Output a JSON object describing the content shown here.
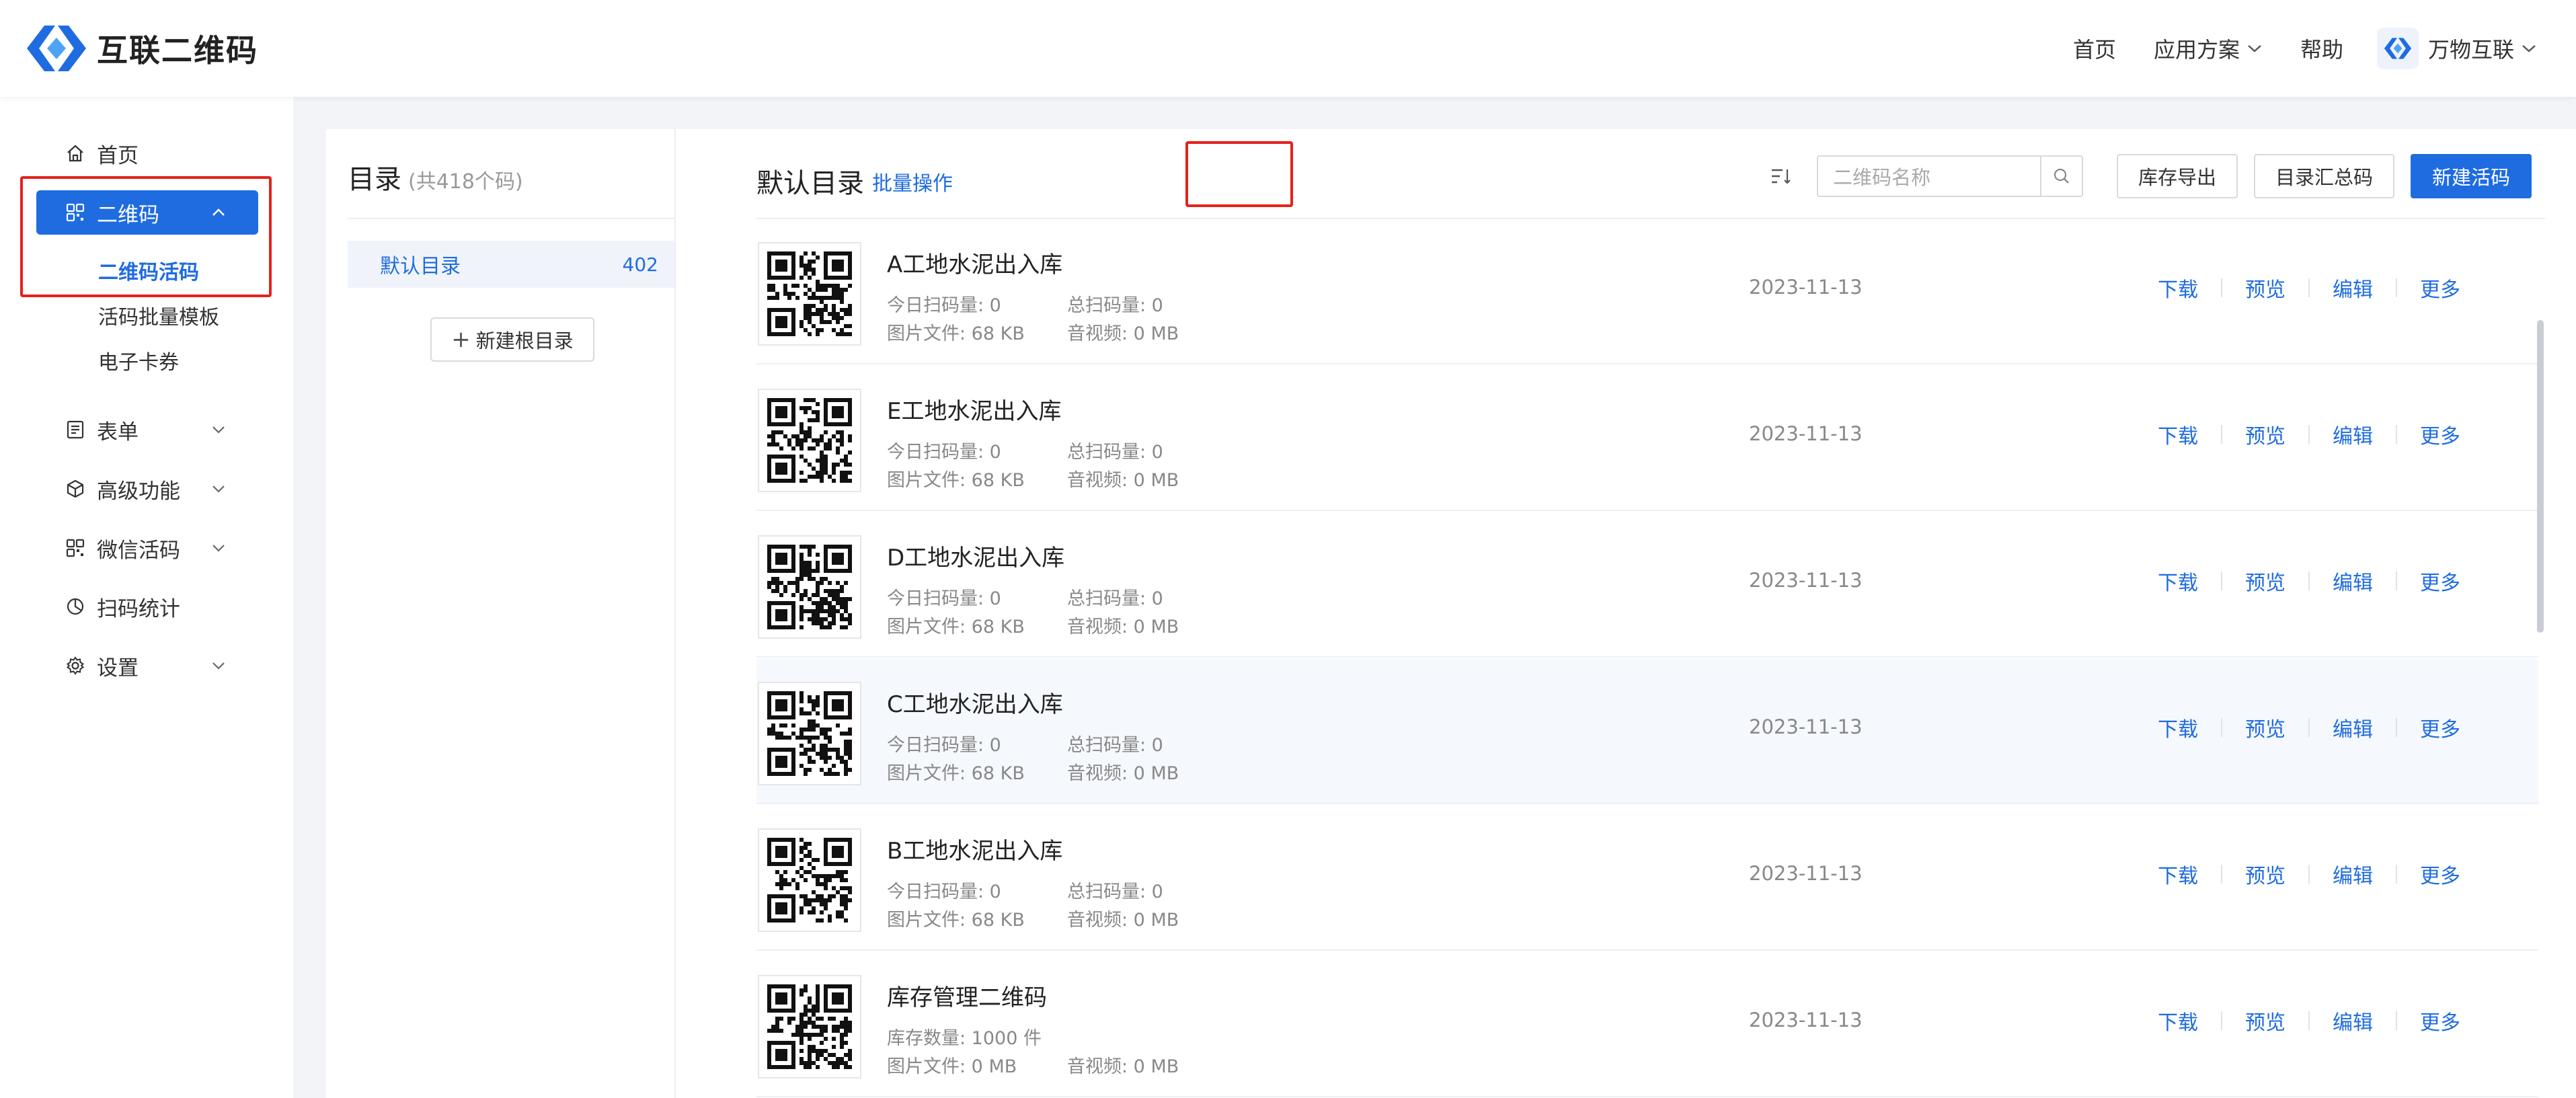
{
  "app": {
    "title": "互联二维码",
    "brand_color": "#1f6ce0",
    "highlight_color": "#e5211b"
  },
  "topnav": {
    "home": "首页",
    "solutions": "应用方案",
    "help": "帮助",
    "user_name": "万物互联"
  },
  "sidebar": {
    "home": "首页",
    "qrcode": "二维码",
    "qrcode_sub": [
      "二维码活码",
      "活码批量模板",
      "电子卡券"
    ],
    "form": "表单",
    "advanced": "高级功能",
    "wechat": "微信活码",
    "stats": "扫码统计",
    "settings": "设置"
  },
  "directory": {
    "title": "目录",
    "count_text": "(共418个码)",
    "default_name": "默认目录",
    "default_count": "402",
    "new_root_label": "新建根目录"
  },
  "list": {
    "title": "默认目录",
    "batch_label": "批量操作",
    "search_placeholder": "二维码名称",
    "export_label": "库存导出",
    "summary_label": "目录汇总码",
    "new_label": "新建活码",
    "actions": {
      "download": "下载",
      "preview": "预览",
      "edit": "编辑",
      "more": "更多"
    },
    "items": [
      {
        "name": "A工地水泥出入库",
        "m1": "今日扫码量: 0",
        "m2": "总扫码量: 0",
        "m3": "图片文件: 68 KB",
        "m4": "音视频: 0 MB",
        "date": "2023-11-13"
      },
      {
        "name": "E工地水泥出入库",
        "m1": "今日扫码量: 0",
        "m2": "总扫码量: 0",
        "m3": "图片文件: 68 KB",
        "m4": "音视频: 0 MB",
        "date": "2023-11-13"
      },
      {
        "name": "D工地水泥出入库",
        "m1": "今日扫码量: 0",
        "m2": "总扫码量: 0",
        "m3": "图片文件: 68 KB",
        "m4": "音视频: 0 MB",
        "date": "2023-11-13"
      },
      {
        "name": "C工地水泥出入库",
        "m1": "今日扫码量: 0",
        "m2": "总扫码量: 0",
        "m3": "图片文件: 68 KB",
        "m4": "音视频: 0 MB",
        "date": "2023-11-13"
      },
      {
        "name": "B工地水泥出入库",
        "m1": "今日扫码量: 0",
        "m2": "总扫码量: 0",
        "m3": "图片文件: 68 KB",
        "m4": "音视频: 0 MB",
        "date": "2023-11-13"
      },
      {
        "name": "库存管理二维码",
        "m1": "库存数量: 1000 件",
        "m2": "",
        "m3": "图片文件: 0 MB",
        "m4": "音视频: 0 MB",
        "date": "2023-11-13"
      }
    ]
  }
}
